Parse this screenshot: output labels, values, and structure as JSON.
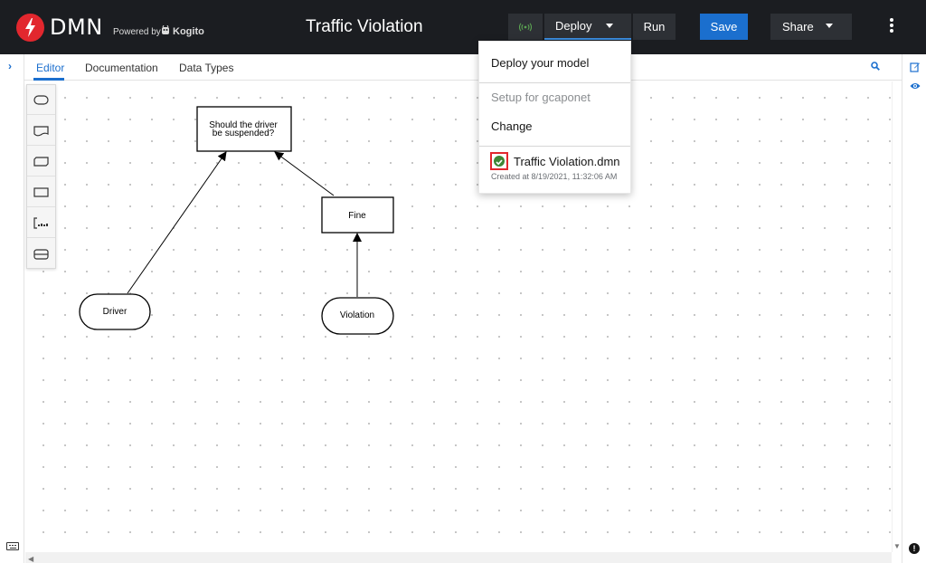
{
  "header": {
    "logo_text": "DMN",
    "powered_by": "Powered by",
    "kogito": "Kogito",
    "title": "Traffic Violation",
    "deploy_label": "Deploy",
    "run_label": "Run",
    "save_label": "Save",
    "share_label": "Share"
  },
  "tabs": [
    {
      "label": "Editor"
    },
    {
      "label": "Documentation"
    },
    {
      "label": "Data Types"
    }
  ],
  "menu": {
    "deploy_model": "Deploy your model",
    "setup": "Setup for gcaponet",
    "change": "Change",
    "file_name": "Traffic Violation.dmn",
    "created": "Created at 8/19/2021, 11:32:06 AM"
  },
  "diagram": {
    "decision_line1": "Should the driver",
    "decision_line2": "be suspended?",
    "fine": "Fine",
    "driver": "Driver",
    "violation": "Violation"
  },
  "colors": {
    "header_bg": "#1b1d21",
    "accent": "#1b6fce",
    "logo_red": "#e2272e",
    "success": "#3e8635"
  }
}
